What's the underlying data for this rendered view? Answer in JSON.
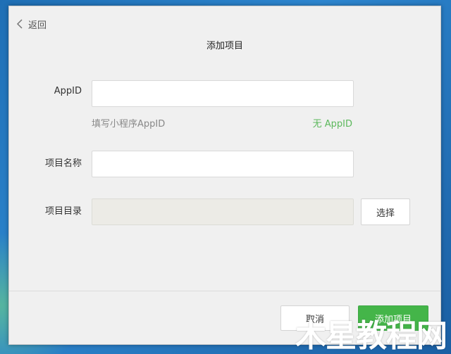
{
  "nav": {
    "back_label": "返回"
  },
  "dialog": {
    "title": "添加项目"
  },
  "form": {
    "appid": {
      "label": "AppID",
      "value": "",
      "hint": "填写小程序AppID",
      "no_appid_link": "无 AppID"
    },
    "project_name": {
      "label": "项目名称",
      "value": ""
    },
    "project_dir": {
      "label": "项目目录",
      "value": "",
      "choose_label": "选择"
    }
  },
  "footer": {
    "cancel_label": "取消",
    "add_label": "添加项目"
  },
  "watermark": {
    "text": "木星教程网"
  },
  "colors": {
    "accent_green": "#44b549",
    "link_green": "#5cb85c",
    "window_bg": "#f0f0f0"
  },
  "icons": {
    "back": "chevron-left-icon"
  }
}
